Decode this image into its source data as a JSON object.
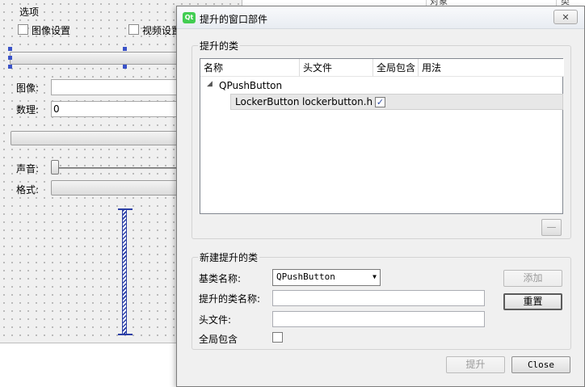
{
  "designer": {
    "group_title": "选项",
    "image_settings_label": "图像设置",
    "video_settings_label": "视频设置",
    "image_label": "图像:",
    "count_label": "数理:",
    "count_value": "0",
    "sound_label": "声音:",
    "format_label": "格式:"
  },
  "object_panel": {
    "col_object": "对象",
    "col_class": "类"
  },
  "dialog": {
    "title": "提升的窗口部件",
    "close_glyph": "✕",
    "promoted_group_title": "提升的类",
    "columns": [
      "名称",
      "头文件",
      "全局包含",
      "用法"
    ],
    "tree": {
      "parent": "QPushButton",
      "child_name": "LockerButton",
      "child_header": "lockerbutton.h",
      "child_global_include": true,
      "child_usage": ""
    },
    "remove_button_glyph": "—",
    "new_group_title": "新建提升的类",
    "base_class_label": "基类名称:",
    "base_class_value": "QPushButton",
    "promoted_class_label": "提升的类名称:",
    "promoted_class_value": "",
    "header_file_label": "头文件:",
    "header_file_value": "",
    "global_include_label": "全局包含",
    "global_include_checked": false,
    "add_button": "添加",
    "reset_button": "重置",
    "promote_button": "提升",
    "close_button": "Close"
  }
}
